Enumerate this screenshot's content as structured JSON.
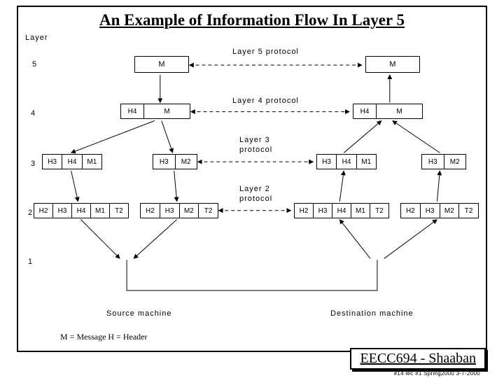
{
  "title": "An Example of Information Flow In Layer 5",
  "header_layer": "Layer",
  "layers": {
    "l5": "5",
    "l4": "4",
    "l3": "3",
    "l2": "2",
    "l1": "1"
  },
  "protocols": {
    "p5": "Layer 5 protocol",
    "p4": "Layer 4 protocol",
    "p3a": "Layer 3",
    "p3b": "protocol",
    "p2a": "Layer 2",
    "p2b": "protocol"
  },
  "boxes": {
    "m": "M",
    "h4": "H4",
    "h3": "H3",
    "h2": "H2",
    "m1": "M1",
    "m2": "M2",
    "t2": "T2"
  },
  "machines": {
    "src": "Source machine",
    "dst": "Destination machine"
  },
  "legend": "M = Message   H = Header",
  "course": "EECC694 - Shaaban",
  "footnote": "#14 lec #1   Spring2000   3-7-2000"
}
